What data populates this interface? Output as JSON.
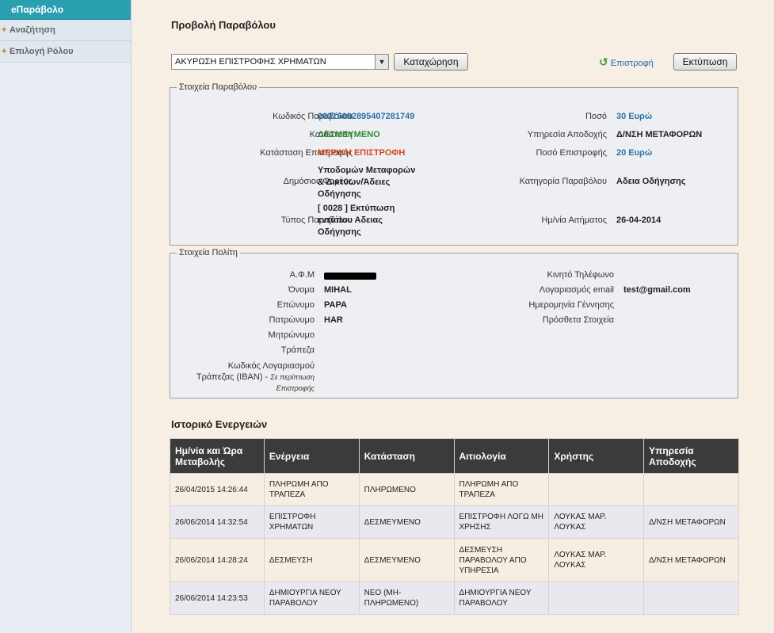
{
  "sidebar": {
    "brand": "eΠαράβολο",
    "items": [
      {
        "label": "Αναζήτηση"
      },
      {
        "label": "Επιλογή Ρόλου"
      }
    ]
  },
  "page": {
    "title": "Προβολή Παραβόλου"
  },
  "toolbar": {
    "action_select_value": "ΑΚΥΡΩΣΗ ΕΠΙΣΤΡΟΦΗΣ ΧΡΗΜΑΤΩΝ",
    "submit_label": "Καταχώρηση",
    "back_label": "Επιστροφή",
    "print_label": "Εκτύπωση"
  },
  "fee_details": {
    "legend": "Στοιχεία Παραβόλου",
    "code_label": "Κωδικός Παραβόλου",
    "code_value": "00316092895407281749",
    "status_label": "Κατάσταση",
    "status_value": "ΔΕΣΜΕΥΜΕΝΟ",
    "refund_status_label": "Κατάσταση Επιστροφής",
    "refund_status_value": "ΜΕΡΙΚΗ ΕΠΙΣΤΡΟΦΗ",
    "agency_label": "Δημόσιος Φορέας",
    "agency_value_1": "Υποδομών Μεταφορών",
    "agency_value_2": "& Δικτύων/Άδειες",
    "agency_value_3": "Οδήγησης",
    "type_label": "Τύπος Παραβόλου",
    "type_value_1": "[ 0028 ] Εκτύπωση",
    "type_value_2": "εντύπου Αδειας",
    "type_value_3": "Οδήγησης",
    "amount_label": "Ποσό",
    "amount_value": "30 Ευρώ",
    "service_label": "Υπηρεσία Αποδοχής",
    "service_value": "Δ/ΝΣΗ ΜΕΤΑΦΟΡΩΝ",
    "refund_amount_label": "Ποσό Επιστροφής",
    "refund_amount_value": "20 Ευρώ",
    "category_label": "Κατηγορία Παραβόλου",
    "category_value": "Αδεια Οδήγησης",
    "request_date_label": "Ημ/νία Αιτήματος",
    "request_date_value": "26-04-2014"
  },
  "citizen": {
    "legend": "Στοιχεία Πολίτη",
    "afm_label": "Α.Φ.Μ",
    "first_name_label": "Όνομα",
    "first_name_value": "MIHAL",
    "last_name_label": "Επώνυμο",
    "last_name_value": "PAPA",
    "father_label": "Πατρώνυμο",
    "father_value": "HAR",
    "mother_label": "Μητρώνυμο",
    "bank_label": "Τράπεζα",
    "iban_label_1": "Κωδικός Λογαριασμού",
    "iban_label_2": "Τράπεζας (IBAN) -",
    "iban_note_1": "Σε περίπτωση",
    "iban_note_2": "Επιστροφής",
    "mobile_label": "Κινητό Τηλέφωνο",
    "email_label": "Λογαριασμός email",
    "email_value": "test@gmail.com",
    "birth_label": "Ημερομηνία Γέννησης",
    "extra_label": "Πρόσθετα Στοιχεία"
  },
  "history": {
    "title": "Ιστορικό Ενεργειών",
    "columns": [
      "Ημ/νία και Ώρα Μεταβολής",
      "Ενέργεια",
      "Κατάσταση",
      "Αιτιολογία",
      "Χρήστης",
      "Υπηρεσία Αποδοχής"
    ],
    "rows": [
      [
        "26/04/2015 14:26:44",
        "ΠΛΗΡΩΜΗ ΑΠΟ ΤΡΑΠΕΖΑ",
        "ΠΛΗΡΩΜΕΝΟ",
        "ΠΛΗΡΩΜΗ ΑΠΟ ΤΡΑΠΕΖΑ",
        "",
        ""
      ],
      [
        "26/06/2014 14:32:54",
        "ΕΠΙΣΤΡΟΦΗ ΧΡΗΜΑΤΩΝ",
        "ΔΕΣΜΕΥΜΕΝΟ",
        "ΕΠΙΣΤΡΟΦΗ ΛΟΓΩ ΜΗ ΧΡΗΣΗΣ",
        "ΛΟΥΚΑΣ ΜΑΡ. ΛΟΥΚΑΣ",
        "Δ/ΝΣΗ ΜΕΤΑΦΟΡΩΝ"
      ],
      [
        "26/06/2014 14:28:24",
        "ΔΕΣΜΕΥΣΗ",
        "ΔΕΣΜΕΥΜΕΝΟ",
        "ΔΕΣΜΕΥΣΗ ΠΑΡΑΒΟΛΟΥ ΑΠΟ ΥΠΗΡΕΣΙΑ",
        "ΛΟΥΚΑΣ ΜΑΡ. ΛΟΥΚΑΣ",
        "Δ/ΝΣΗ ΜΕΤΑΦΟΡΩΝ"
      ],
      [
        "26/06/2014 14:23:53",
        "ΔΗΜΙΟΥΡΓΙΑ ΝΕΟΥ ΠΑΡΑΒΟΛΟΥ",
        "ΝΕΟ (ΜΗ-ΠΛΗΡΩΜΕΝΟ)",
        "ΔΗΜΙΟΥΡΓΙΑ ΝΕΟΥ ΠΑΡΑΒΟΛΟΥ",
        "",
        ""
      ]
    ]
  }
}
